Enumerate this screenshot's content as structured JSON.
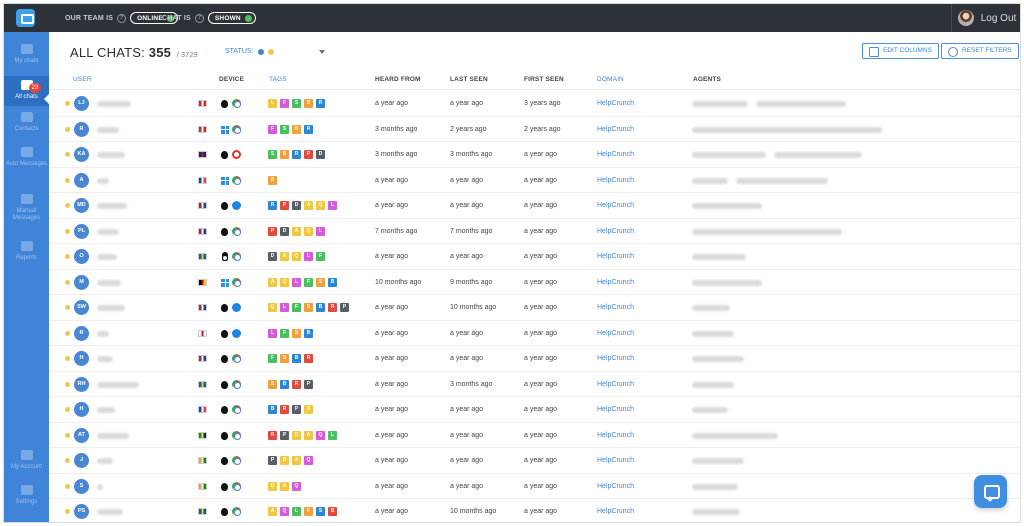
{
  "topbar": {
    "our_team_label": "OUR TEAM IS",
    "our_team_status": "ONLINE",
    "chat_label": "CHAT IS",
    "chat_status": "SHOWN",
    "logout": "Log Out"
  },
  "sidebar": {
    "items": [
      {
        "label": "My chats"
      },
      {
        "label": "All chats",
        "badge": "23"
      },
      {
        "label": "Contacts"
      },
      {
        "label": "Auto Messages"
      },
      {
        "label": "Manual Messages"
      },
      {
        "label": "Reports"
      },
      {
        "label": "My Account"
      },
      {
        "label": "Settings"
      }
    ]
  },
  "header": {
    "title_prefix": "ALL CHATS:",
    "count": "355",
    "total": "/ 3729",
    "status_label": "STATUS:",
    "edit_columns": "EDIT COLUMNS",
    "reset_filters": "RESET FILTERS"
  },
  "columns": [
    "USER",
    "DEVICE",
    "TAGS",
    "HEARD FROM",
    "LAST SEEN",
    "FIRST SEEN",
    "DOMAIN",
    "AGENTS"
  ],
  "rows": [
    {
      "initials": "LJ",
      "heard": "a year ago",
      "last": "a year ago",
      "first": "3 years ago",
      "domain": "HelpCrunch"
    },
    {
      "initials": "R",
      "heard": "3 months ago",
      "last": "2 years ago",
      "first": "2 years ago",
      "domain": "HelpCrunch"
    },
    {
      "initials": "KA",
      "heard": "3 months ago",
      "last": "3 months ago",
      "first": "a year ago",
      "domain": "HelpCrunch"
    },
    {
      "initials": "A",
      "heard": "a year ago",
      "last": "a year ago",
      "first": "a year ago",
      "domain": "HelpCrunch"
    },
    {
      "initials": "MD",
      "heard": "a year ago",
      "last": "a year ago",
      "first": "a year ago",
      "domain": "HelpCrunch"
    },
    {
      "initials": "PL",
      "heard": "7 months ago",
      "last": "7 months ago",
      "first": "a year ago",
      "domain": "HelpCrunch"
    },
    {
      "initials": "O",
      "heard": "a year ago",
      "last": "a year ago",
      "first": "a year ago",
      "domain": "HelpCrunch"
    },
    {
      "initials": "M",
      "heard": "10 months ago",
      "last": "9 months ago",
      "first": "a year ago",
      "domain": "HelpCrunch"
    },
    {
      "initials": "SW",
      "heard": "a year ago",
      "last": "10 months ago",
      "first": "a year ago",
      "domain": "HelpCrunch"
    },
    {
      "initials": "R",
      "heard": "a year ago",
      "last": "a year ago",
      "first": "a year ago",
      "domain": "HelpCrunch"
    },
    {
      "initials": "H",
      "heard": "a year ago",
      "last": "a year ago",
      "first": "a year ago",
      "domain": "HelpCrunch"
    },
    {
      "initials": "RH",
      "heard": "a year ago",
      "last": "3 months ago",
      "first": "a year ago",
      "domain": "HelpCrunch"
    },
    {
      "initials": "H",
      "heard": "a year ago",
      "last": "a year ago",
      "first": "a year ago",
      "domain": "HelpCrunch"
    },
    {
      "initials": "AT",
      "heard": "a year ago",
      "last": "a year ago",
      "first": "a year ago",
      "domain": "HelpCrunch"
    },
    {
      "initials": "J",
      "heard": "a year ago",
      "last": "a year ago",
      "first": "a year ago",
      "domain": "HelpCrunch"
    },
    {
      "initials": "S",
      "heard": "a year ago",
      "last": "a year ago",
      "first": "a year ago",
      "domain": "HelpCrunch"
    },
    {
      "initials": "PS",
      "heard": "a year ago",
      "last": "10 months ago",
      "first": "a year ago",
      "domain": "HelpCrunch"
    }
  ],
  "colors": {
    "sidebar": "#3f84d8",
    "topbar": "#2d3238",
    "accent": "#3f86d4"
  }
}
